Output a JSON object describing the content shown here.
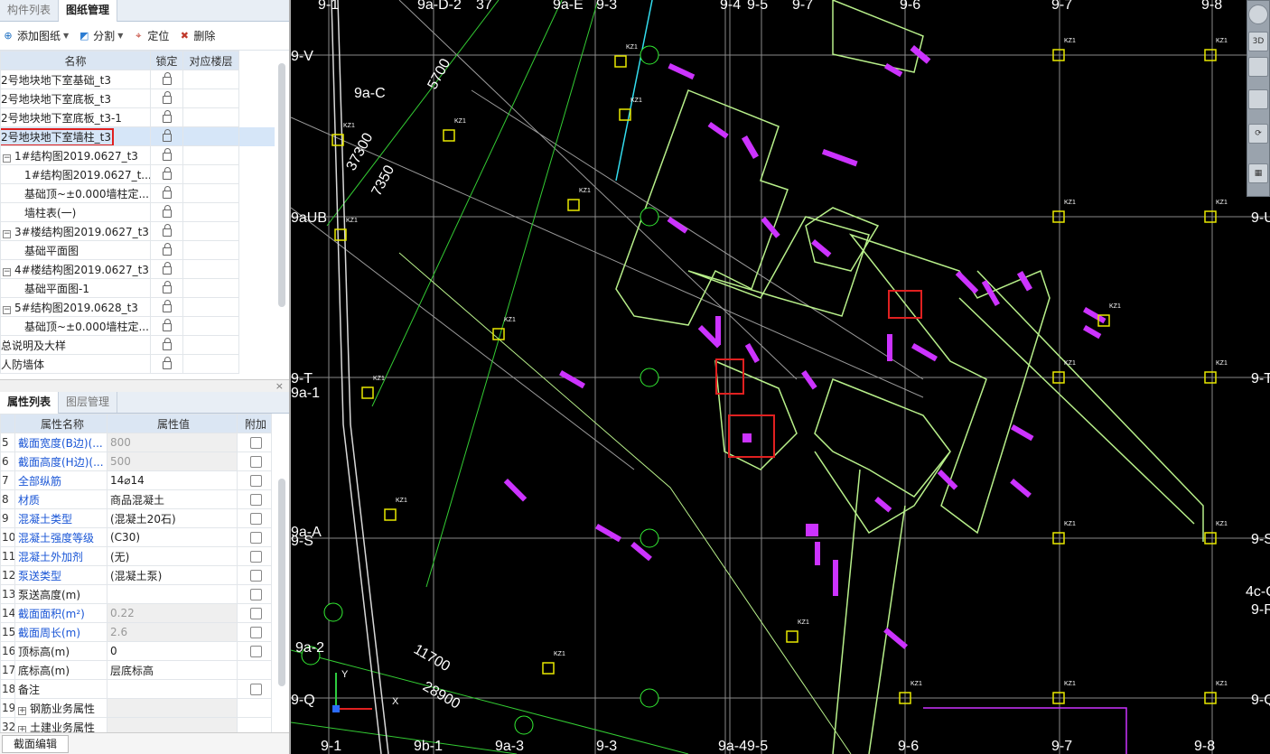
{
  "left_panel": {
    "tabs": [
      "构件列表",
      "图纸管理"
    ],
    "toolbar": {
      "add_drawing": "添加图纸",
      "split": "分割",
      "locate": "定位",
      "delete": "删除"
    },
    "drawing_table": {
      "headers": [
        "名称",
        "锁定",
        "对应楼层"
      ],
      "rows": [
        {
          "name": "2号地块地下室基础_t3"
        },
        {
          "name": "2号地块地下室底板_t3"
        },
        {
          "name": "2号地块地下室底板_t3-1"
        },
        {
          "name": "2号地块地下室墙柱_t3"
        },
        {
          "name": "1#结构图2019.0627_t3"
        },
        {
          "name": "1#结构图2019.0627_t..."
        },
        {
          "name": "基础顶~±0.000墙柱定..."
        },
        {
          "name": "墙柱表(一)"
        },
        {
          "name": "3#楼结构图2019.0627_t3"
        },
        {
          "name": "基础平面图"
        },
        {
          "name": "4#楼结构图2019.0627_t3"
        },
        {
          "name": "基础平面图-1"
        },
        {
          "name": "5#结构图2019.0628_t3"
        },
        {
          "name": "基础顶~±0.000墙柱定..."
        },
        {
          "name": "总说明及大样"
        },
        {
          "name": "人防墙体"
        }
      ],
      "expand_symbol": "−"
    },
    "close_symbol": "×",
    "prop_tabs": [
      "属性列表",
      "图层管理"
    ],
    "prop_table": {
      "headers": [
        "属性名称",
        "属性值",
        "附加"
      ],
      "rows": [
        {
          "num": "5",
          "name": "截面宽度(B边)(...",
          "value": "800"
        },
        {
          "num": "6",
          "name": "截面高度(H边)(...",
          "value": "500"
        },
        {
          "num": "7",
          "name": "全部纵筋",
          "value": "14⌀14"
        },
        {
          "num": "8",
          "name": "材质",
          "value": "商品混凝土"
        },
        {
          "num": "9",
          "name": "混凝土类型",
          "value": "(混凝土20石)"
        },
        {
          "num": "10",
          "name": "混凝土强度等级",
          "value": "(C30)"
        },
        {
          "num": "11",
          "name": "混凝土外加剂",
          "value": "(无)"
        },
        {
          "num": "12",
          "name": "泵送类型",
          "value": "(混凝土泵)"
        },
        {
          "num": "13",
          "name": "泵送高度(m)",
          "value": ""
        },
        {
          "num": "14",
          "name": "截面面积(m²)",
          "value": "0.22"
        },
        {
          "num": "15",
          "name": "截面周长(m)",
          "value": "2.6"
        },
        {
          "num": "16",
          "name": "顶标高(m)",
          "value": "0"
        },
        {
          "num": "17",
          "name": "底标高(m)",
          "value": "层底标高"
        },
        {
          "num": "18",
          "name": "备注",
          "value": ""
        },
        {
          "num": "19",
          "name": "钢筋业务属性",
          "value": ""
        },
        {
          "num": "32",
          "name": "土建业务属性",
          "value": ""
        }
      ],
      "expand_symbol": "+"
    },
    "bottom_button": "截面编辑"
  },
  "cad": {
    "axis_labels_top": [
      "9-1",
      "9a-D-2",
      "37",
      "9a-E",
      "9-3",
      "9-4",
      "9-5",
      "9-7",
      "9-6",
      "9-7",
      "9-8"
    ],
    "axis_labels_bottom": [
      "9-1",
      "9b-1",
      "9a-3",
      "9-3",
      "9a-4",
      "9-5",
      "9-6",
      "9-7",
      "9-8"
    ],
    "axis_labels_left": [
      "9-V",
      "9a-C",
      "9aUB",
      "9-T",
      "9a-1",
      "9a-A",
      "9-S",
      "9a-2",
      "9-Q"
    ],
    "axis_labels_right": [
      "9-U",
      "9-T",
      "9-S",
      "4c-C",
      "9-R",
      "9-Q"
    ],
    "dimension_labels": [
      "5700",
      "37300",
      "7350",
      "11700",
      "28900"
    ],
    "column_tag": "KZ1",
    "cursor_y": "Y",
    "cursor_x": "X",
    "right_toolbar": [
      "3D"
    ]
  },
  "colors": {
    "cad_background": "#000000",
    "wall_green": "#b8f08a",
    "column_magenta": "#cc33ff",
    "column_yellow": "#e8e800",
    "grid_gray": "#8a8a8a",
    "highlight_red": "#e02020",
    "label_blue": "#1a56d6"
  }
}
